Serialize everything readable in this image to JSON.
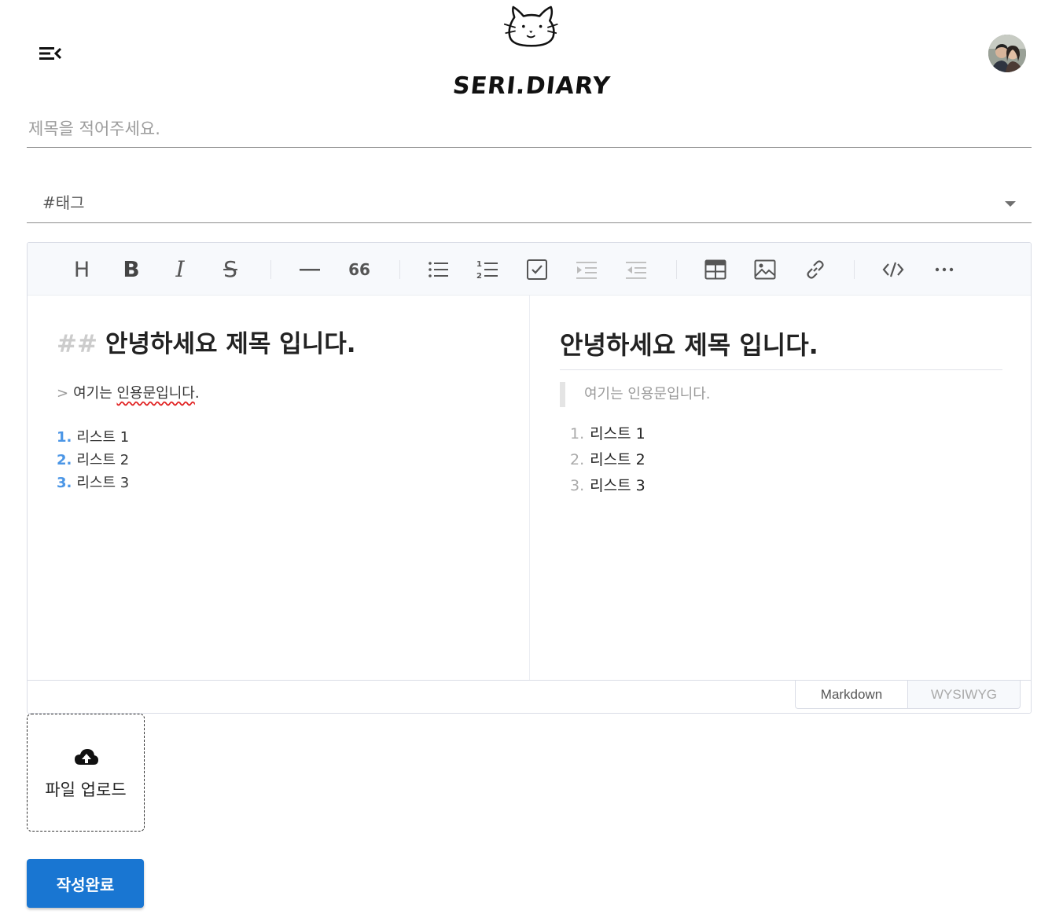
{
  "header": {
    "menu_icon": "menu-collapse-icon",
    "logo_text": "SERI.DIARY",
    "logo_icon": "cat-face-icon",
    "avatar_icon": "user-avatar"
  },
  "form": {
    "title_placeholder": "제목을 적어주세요.",
    "title_value": "",
    "tag_label": "#태그"
  },
  "editor": {
    "toolbar": [
      "heading-icon",
      "bold-icon",
      "italic-icon",
      "strike-icon",
      "hr-icon",
      "quote-icon",
      "bullet-list-icon",
      "ordered-list-icon",
      "task-list-icon",
      "indent-icon",
      "outdent-icon",
      "table-icon",
      "image-icon",
      "link-icon",
      "code-icon",
      "more-icon"
    ],
    "toolbar_text": {
      "heading": "H",
      "bold": "B",
      "italic": "I",
      "strike": "S",
      "quote": "66"
    },
    "markdown": {
      "heading_hash": "##",
      "heading_text": "안녕하세요 제목 입니다.",
      "quote_marker": ">",
      "quote_prefix": "여기는 ",
      "quote_misspelled": "인용문입니다",
      "quote_suffix": ".",
      "list": [
        {
          "num": "1.",
          "text": "리스트 1"
        },
        {
          "num": "2.",
          "text": "리스트 2"
        },
        {
          "num": "3.",
          "text": "리스트 3"
        }
      ]
    },
    "preview": {
      "heading_text": "안녕하세요 제목 입니다.",
      "quote_text": "여기는 인용문입니다.",
      "list": [
        {
          "num": "1.",
          "text": "리스트 1"
        },
        {
          "num": "2.",
          "text": "리스트 2"
        },
        {
          "num": "3.",
          "text": "리스트 3"
        }
      ]
    },
    "modes": {
      "markdown": "Markdown",
      "wysiwyg": "WYSIWYG",
      "active": "Markdown"
    }
  },
  "upload": {
    "label": "파일 업로드",
    "icon": "cloud-upload-icon"
  },
  "submit_label": "작성완료",
  "colors": {
    "primary": "#1976d2",
    "list_number": "#4b96e6",
    "toolbar_bg": "#f7f9fc"
  }
}
